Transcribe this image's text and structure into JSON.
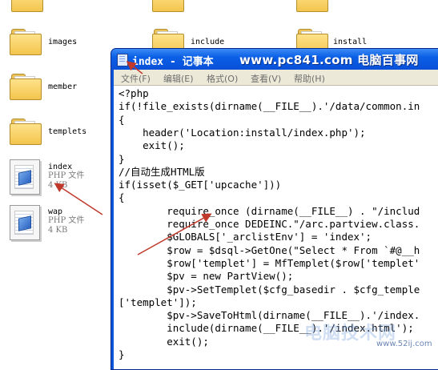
{
  "desktop": {
    "top_labels": [
      "include",
      "install"
    ],
    "folders": [
      {
        "label": "images"
      },
      {
        "label": "member"
      },
      {
        "label": "templets"
      }
    ],
    "files": [
      {
        "name": "index",
        "type": "PHP 文件",
        "size": "4 KB"
      },
      {
        "name": "wap",
        "type": "PHP 文件",
        "size": "4 KB"
      }
    ]
  },
  "window": {
    "title": "index - 记事本",
    "watermark": "www.pc841.com 电脑百事网",
    "menu": [
      "文件(F)",
      "编辑(E)",
      "格式(O)",
      "查看(V)",
      "帮助(H)"
    ],
    "code_lines": [
      "<?php",
      "if(!file_exists(dirname(__FILE__).'/data/common.in",
      "{",
      "    header('Location:install/index.php');",
      "    exit();",
      "}",
      "//自动生成HTML版",
      "if(isset($_GET['upcache']))",
      "{",
      "        require_once (dirname(__FILE__) . \"/includ",
      "        require_once DEDEINC.\"/arc.partview.class.",
      "        $GLOBALS['_arclistEnv'] = 'index';",
      "        $row = $dsql->GetOne(\"Select * From `#@__h",
      "        $row['templet'] = MfTemplet($row['templet'",
      "        $pv = new PartView();",
      "        $pv->SetTemplet($cfg_basedir . $cfg_temple",
      "['templet']);",
      "        $pv->SaveToHtml(dirname(__FILE__).'/index.",
      "        include(dirname(__FILE__).'/index.html');",
      "        exit();",
      "}"
    ]
  },
  "watermarks": {
    "logo": "电脑技术网",
    "site": "www.52ij.com"
  },
  "colors": {
    "titlebar": "#0a5fe6",
    "menubar": "#ece9d8",
    "annotation_arrow": "#c0392b"
  }
}
